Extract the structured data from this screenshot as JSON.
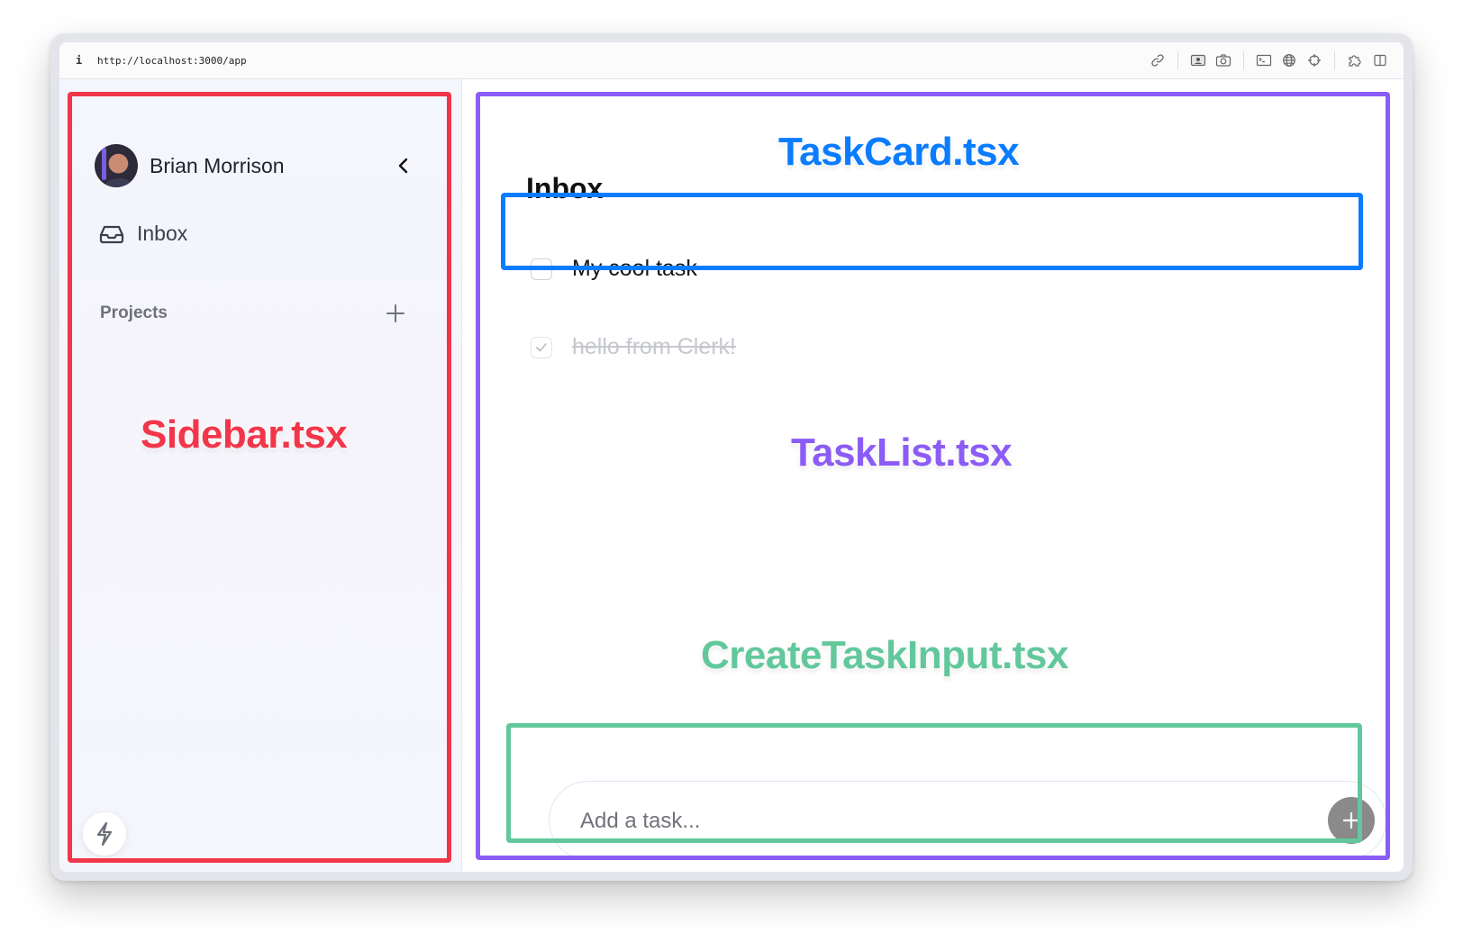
{
  "browser": {
    "url": "http://localhost:3000/app",
    "toolbar_icons": [
      "link-icon",
      "screencast-icon",
      "camera-icon",
      "terminal-icon",
      "globe-icon",
      "crosshair-icon",
      "extension-icon",
      "split-view-icon"
    ]
  },
  "sidebar": {
    "user_name": "Brian Morrison",
    "nav": [
      {
        "label": "Inbox",
        "icon": "inbox-icon"
      }
    ],
    "projects_label": "Projects"
  },
  "main": {
    "title": "Inbox",
    "tasks": [
      {
        "label": "My cool task",
        "completed": false
      },
      {
        "label": "hello from Clerk!",
        "completed": true
      }
    ],
    "create_input": {
      "placeholder": "Add a task...",
      "value": ""
    }
  },
  "annotations": {
    "sidebar": {
      "label": "Sidebar.tsx",
      "color": "#f2364a"
    },
    "task_list": {
      "label": "TaskList.tsx",
      "color": "#8b5cf6"
    },
    "task_card": {
      "label": "TaskCard.tsx",
      "color": "#0a7cff"
    },
    "create_task_input": {
      "label": "CreateTaskInput.tsx",
      "color": "#62c89c"
    }
  }
}
